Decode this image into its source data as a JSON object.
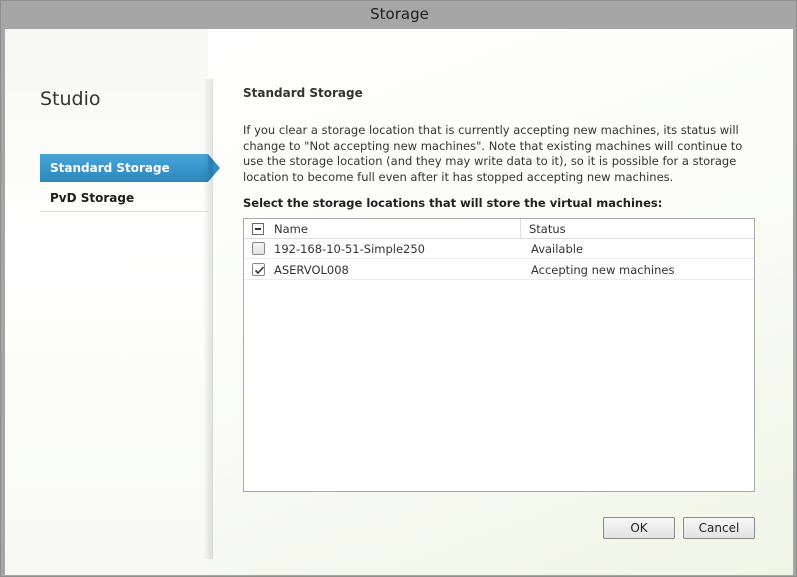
{
  "window": {
    "title": "Storage"
  },
  "sidebar": {
    "heading": "Studio",
    "items": [
      {
        "label": "Standard Storage",
        "active": true
      },
      {
        "label": "PvD Storage",
        "active": false
      }
    ]
  },
  "main": {
    "title": "Standard Storage",
    "description": "If you clear a storage location that is currently accepting new machines, its status will change to \"Not accepting new machines\". Note that existing machines will continue to use the storage location (and they may write data to it), so it is possible for a storage location to become full even after it has stopped accepting new machines.",
    "select_label": "Select the storage locations that will store the virtual machines:",
    "table": {
      "columns": [
        "Name",
        "Status"
      ],
      "header_checkbox": "indeterminate",
      "rows": [
        {
          "name": "192-168-10-51-Simple250",
          "status": "Available",
          "checked": false
        },
        {
          "name": "ASERVOL008",
          "status": "Accepting new machines",
          "checked": true
        }
      ]
    }
  },
  "buttons": {
    "ok": "OK",
    "cancel": "Cancel"
  },
  "colors": {
    "accent": "#3a96cc",
    "window_chrome": "#a6a6a6"
  }
}
